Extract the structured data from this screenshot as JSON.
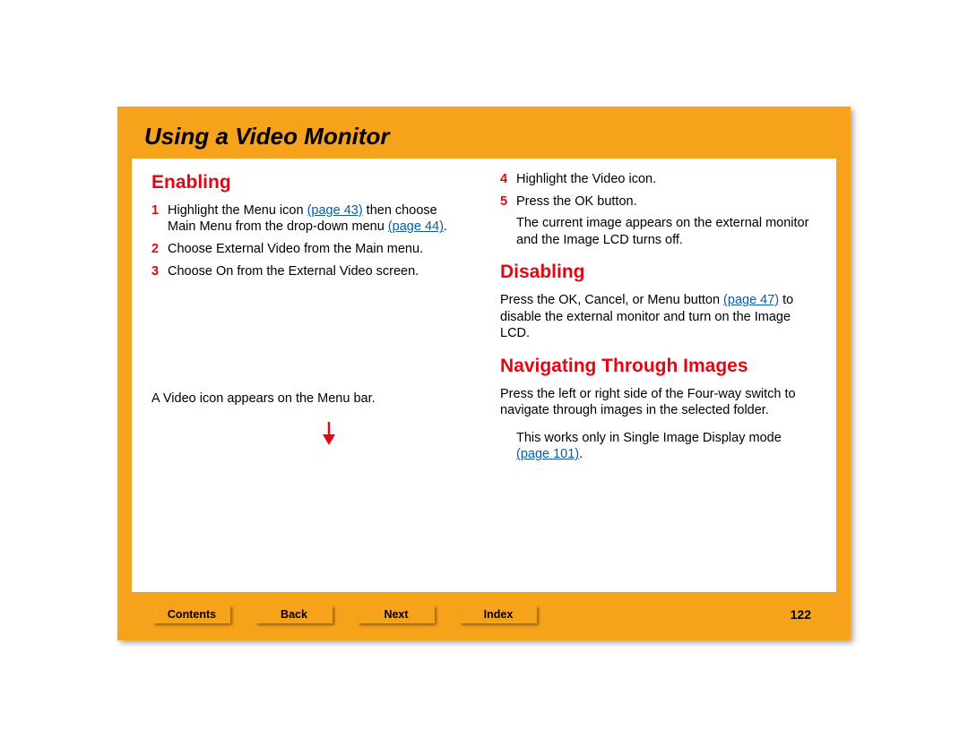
{
  "title": "Using a Video Monitor",
  "left": {
    "heading": "Enabling",
    "steps": [
      {
        "num": "1",
        "pre": "Highlight the Menu icon ",
        "link1": "(page 43)",
        "mid": " then choose Main Menu from the drop-down menu ",
        "link2": "(page 44)",
        "post": "."
      },
      {
        "num": "2",
        "text": "Choose External Video from the Main menu."
      },
      {
        "num": "3",
        "text": "Choose On from the External Video screen."
      }
    ],
    "caption": "A Video icon appears on the Menu bar."
  },
  "right": {
    "step4": {
      "num": "4",
      "text": "Highlight the Video icon."
    },
    "step5": {
      "num": "5",
      "text": "Press the OK button."
    },
    "result": "The current image appears on the external monitor and the Image LCD turns off.",
    "disabling_heading": "Disabling",
    "disabling_pre": "Press the OK, Cancel, or Menu button ",
    "disabling_link": "(page 47)",
    "disabling_post": " to disable the external monitor and turn on the Image LCD.",
    "nav_heading": "Navigating Through Images",
    "nav_text": "Press the left or right side of the Four-way switch to navigate through images in the selected folder.",
    "nav_note_pre": "This works only in Single Image Display mode ",
    "nav_note_link": "(page 101)",
    "nav_note_post": "."
  },
  "footer": {
    "contents": "Contents",
    "back": "Back",
    "next": "Next",
    "index": "Index",
    "page": "122"
  }
}
